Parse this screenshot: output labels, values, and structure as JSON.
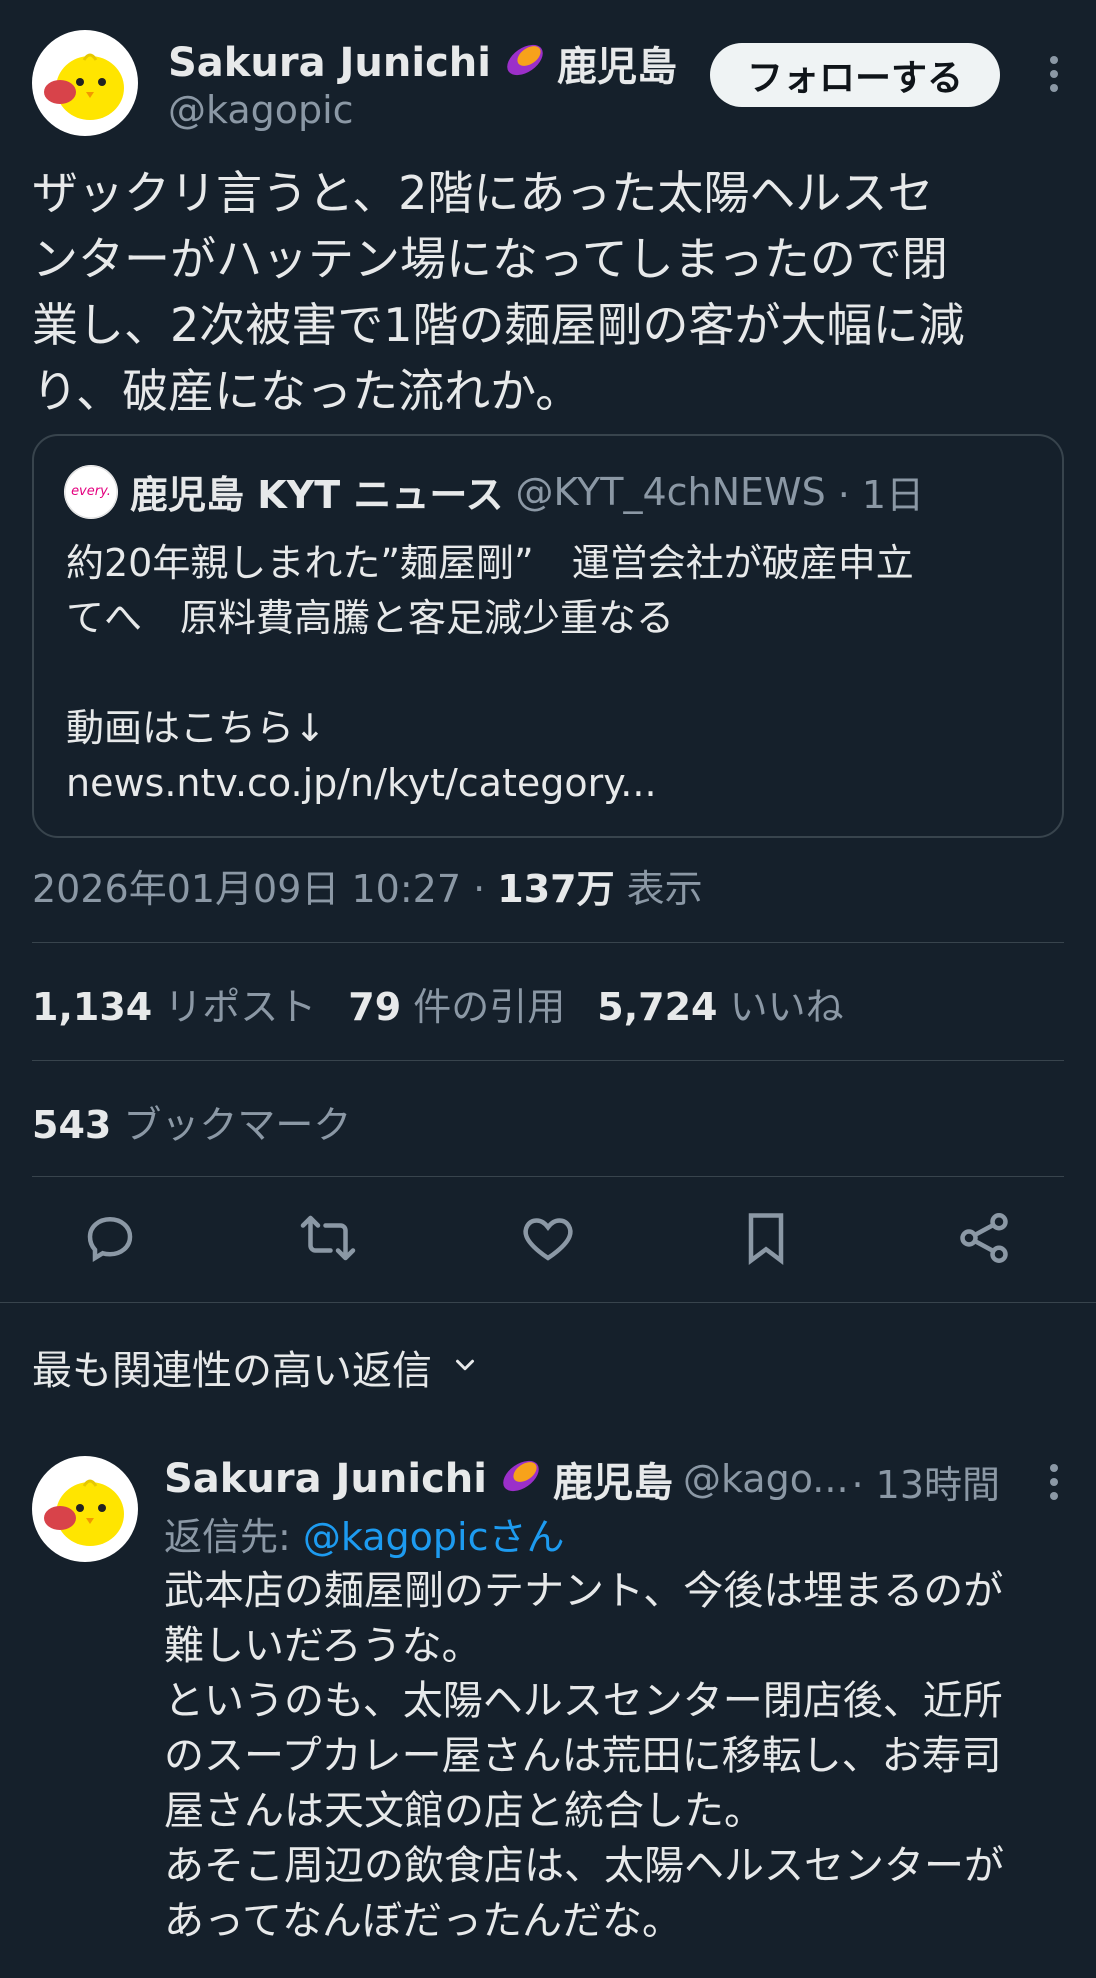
{
  "author": {
    "name": "Sakura Junichi",
    "badge_icon": "sweet-potato-icon",
    "location": "鹿児島",
    "handle": "@kagopic"
  },
  "follow_button": {
    "label": "フォローする"
  },
  "tweet": {
    "lines": [
      "ザックリ言うと、2階にあった太陽ヘルスセ",
      "ンターがハッテン場になってしまったので閉",
      "業し、2次被害で1階の麺屋剛の客が大幅に減",
      "り、破産になった流れか。"
    ]
  },
  "quote": {
    "avatar_text": "every.",
    "name": "鹿児島 KYT ニュース",
    "handle": "@KYT_4chNEWS",
    "time": "· 1日",
    "lines": [
      "約20年親しまれた”麺屋剛”　運営会社が破産申立",
      "てへ　原料費高騰と客足減少重なる",
      "",
      "動画はこちら↓",
      "news.ntv.co.jp/n/kyt/category..."
    ]
  },
  "meta": {
    "datetime": "2026年01月09日 10:27 · ",
    "views_count": "137万",
    "views_label": " 表示"
  },
  "stats": {
    "reposts_count": "1,134",
    "reposts_label": " リポスト",
    "quotes_count": "79",
    "quotes_label": " 件の引用",
    "likes_count": "5,724",
    "likes_label": " いいね",
    "bookmarks_count": "543",
    "bookmarks_label": " ブックマーク"
  },
  "sort": {
    "label": "最も関連性の高い返信"
  },
  "reply": {
    "name": "Sakura Junichi",
    "location": "鹿児島",
    "handle": "@kago...",
    "time": "· 13時間",
    "reply_to_prefix": "返信先: ",
    "reply_to_handle": "@kagopicさん",
    "lines": [
      "武本店の麺屋剛のテナント、今後は埋まるのが",
      "難しいだろうな。",
      "というのも、太陽ヘルスセンター閉店後、近所",
      "のスープカレー屋さんは荒田に移転し、お寿司",
      "屋さんは天文館の店と統合した。",
      "あそこ周辺の飲食店は、太陽ヘルスセンターが",
      "あってなんぼだったんだな。"
    ]
  },
  "colors": {
    "background": "#15202b",
    "text": "#e7e9ea",
    "muted": "#8b98a5",
    "link": "#1d9bf0",
    "border": "#38444d"
  }
}
